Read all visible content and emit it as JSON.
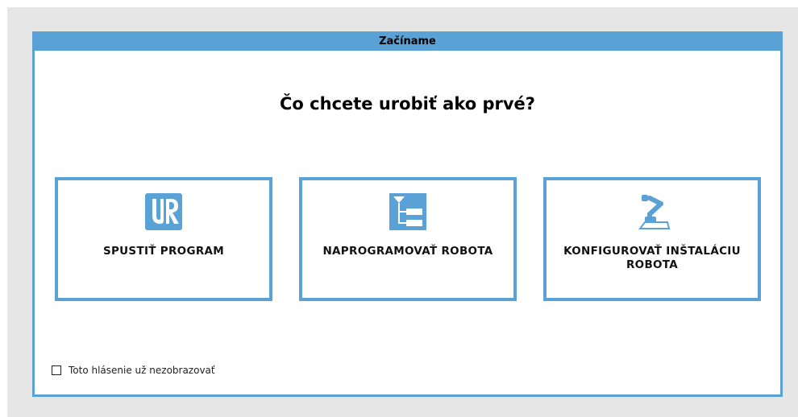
{
  "dialog": {
    "title": "Začíname",
    "heading": "Čo chcete urobiť ako prvé?",
    "accent_color": "#5aa2d6"
  },
  "cards": [
    {
      "label": "SPUSTIŤ PROGRAM",
      "icon": "ur-logo-icon"
    },
    {
      "label": "NAPROGRAMOVAŤ ROBOTA",
      "icon": "program-tree-icon"
    },
    {
      "label": "KONFIGUROVAŤ INŠTALÁCIU ROBOTA",
      "icon": "robot-arm-icon"
    }
  ],
  "footer": {
    "checkbox_label": "Toto hlásenie už nezobrazovať",
    "checked": false
  }
}
